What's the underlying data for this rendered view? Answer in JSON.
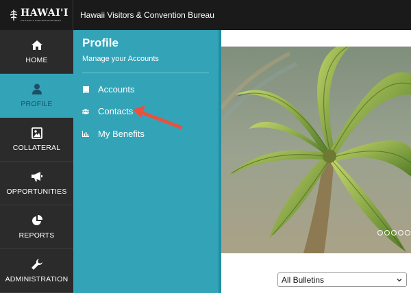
{
  "brand": {
    "logo_text": "HAWAI'I",
    "logo_subtext": "VISITORS & CONVENTION BUREAU",
    "title": "Hawaii Visitors & Convention Bureau"
  },
  "nav": {
    "items": [
      {
        "label": "HOME",
        "icon": "home-icon"
      },
      {
        "label": "PROFILE",
        "icon": "user-icon",
        "active": true
      },
      {
        "label": "COLLATERAL",
        "icon": "image-icon"
      },
      {
        "label": "OPPORTUNITIES",
        "icon": "megaphone-icon"
      },
      {
        "label": "REPORTS",
        "icon": "pie-chart-icon"
      },
      {
        "label": "ADMINISTRATION",
        "icon": "wrench-icon"
      }
    ]
  },
  "subpanel": {
    "title": "Profile",
    "description": "Manage your Accounts",
    "items": [
      {
        "label": "Accounts",
        "icon": "book-icon"
      },
      {
        "label": "Contacts",
        "icon": "users-icon"
      },
      {
        "label": "My Benefits",
        "icon": "bar-chart-icon"
      }
    ]
  },
  "main": {
    "bulletin_filter": {
      "selected": "All Bulletins"
    }
  },
  "colors": {
    "topbar": "#1a1a1a",
    "nav": "#2b2b2b",
    "accent": "#33a4b8",
    "arrow": "#e8513f"
  }
}
